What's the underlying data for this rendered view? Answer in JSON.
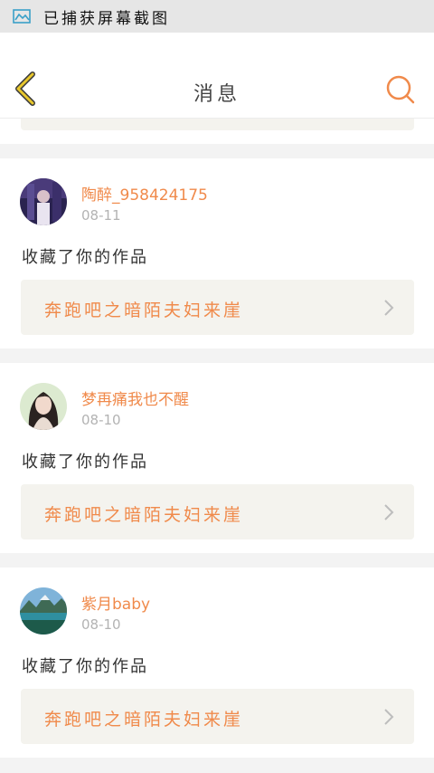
{
  "status_bar": {
    "icon": "screenshot-icon",
    "text": "已捕获屏幕截图"
  },
  "header": {
    "title": "消息",
    "back_icon": "chevron-left-icon",
    "search_icon": "search-icon",
    "accent": "#f08a4b",
    "back_color": "#e8c72c"
  },
  "messages": [
    {
      "username": "陶醉_958424175",
      "date": "08-11",
      "action": "收藏了你的作品",
      "work_title": "奔跑吧之暗陌夫妇来崖"
    },
    {
      "username": "梦再痛我也不醒",
      "date": "08-10",
      "action": "收藏了你的作品",
      "work_title": "奔跑吧之暗陌夫妇来崖"
    },
    {
      "username": "紫月baby",
      "date": "08-10",
      "action": "收藏了你的作品",
      "work_title": "奔跑吧之暗陌夫妇来崖"
    }
  ]
}
